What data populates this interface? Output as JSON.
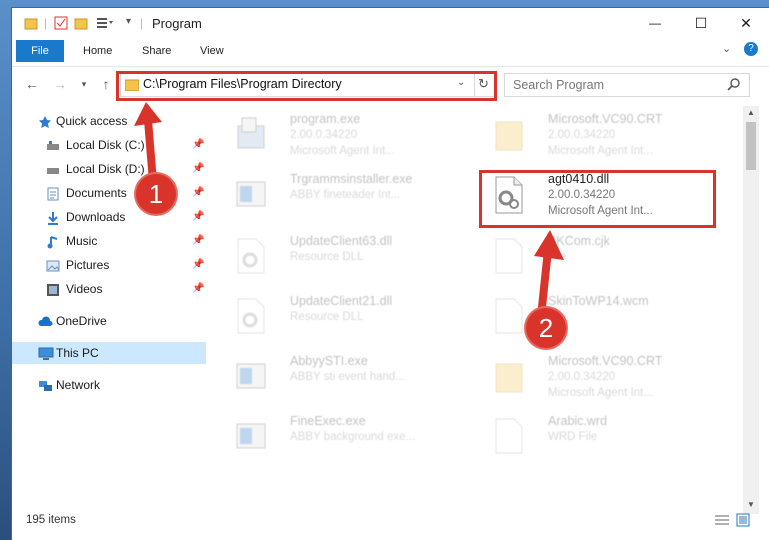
{
  "window": {
    "title": "Program",
    "minimize": "—",
    "maximize": "☐",
    "close": "✕"
  },
  "ribbon": {
    "tabs": [
      "File",
      "Home",
      "Share",
      "View"
    ]
  },
  "address": {
    "path": "C:\\Program Files\\Program Directory",
    "search_placeholder": "Search Program"
  },
  "sidebar": {
    "items": [
      {
        "label": "Quick access",
        "icon": "star-icon"
      },
      {
        "label": "Local Disk (C:)",
        "icon": "drive-icon"
      },
      {
        "label": "Local Disk (D:)",
        "icon": "drive-icon"
      },
      {
        "label": "Documents",
        "icon": "documents-icon"
      },
      {
        "label": "Downloads",
        "icon": "downloads-icon"
      },
      {
        "label": "Music",
        "icon": "music-icon"
      },
      {
        "label": "Pictures",
        "icon": "pictures-icon"
      },
      {
        "label": "Videos",
        "icon": "videos-icon"
      },
      {
        "label": "OneDrive",
        "icon": "cloud-icon"
      },
      {
        "label": "This PC",
        "icon": "computer-icon"
      },
      {
        "label": "Network",
        "icon": "network-icon"
      }
    ]
  },
  "files": [
    {
      "name": "program.exe",
      "line1": "2.00.0.34220",
      "line2": "Microsoft Agent Int..."
    },
    {
      "name": "Microsoft.VC90.CRT",
      "line1": "2.00.0.34220",
      "line2": "Microsoft Agent Int..."
    },
    {
      "name": "Trgrammsinstaller.exe",
      "line1": "ABBY fineteader Int...",
      "line2": ""
    },
    {
      "name": "agt0410.dll",
      "line1": "2.00.0.34220",
      "line2": "Microsoft Agent Int..."
    },
    {
      "name": "UpdateClient63.dll",
      "line1": "Resource DLL",
      "line2": ""
    },
    {
      "name": "BKCom.cjk",
      "line1": "File",
      "line2": ""
    },
    {
      "name": "UpdateClient21.dll",
      "line1": "Resource DLL",
      "line2": ""
    },
    {
      "name": "SkinToWP14.wcm",
      "line1": "File",
      "line2": ""
    },
    {
      "name": "AbbyySTI.exe",
      "line1": "ABBY sti event hand...",
      "line2": ""
    },
    {
      "name": "Microsoft.VC90.CRT",
      "line1": "2.00.0.34220",
      "line2": "Microsoft Agent Int..."
    },
    {
      "name": "FineExec.exe",
      "line1": "ABBY background exe...",
      "line2": ""
    },
    {
      "name": "Arabic.wrd",
      "line1": "WRD File",
      "line2": ""
    }
  ],
  "status": {
    "count": "195 items"
  },
  "callouts": {
    "one": "1",
    "two": "2"
  },
  "colors": {
    "highlight": "#d9342b",
    "accent": "#1979ca",
    "selected": "#cce8ff"
  }
}
